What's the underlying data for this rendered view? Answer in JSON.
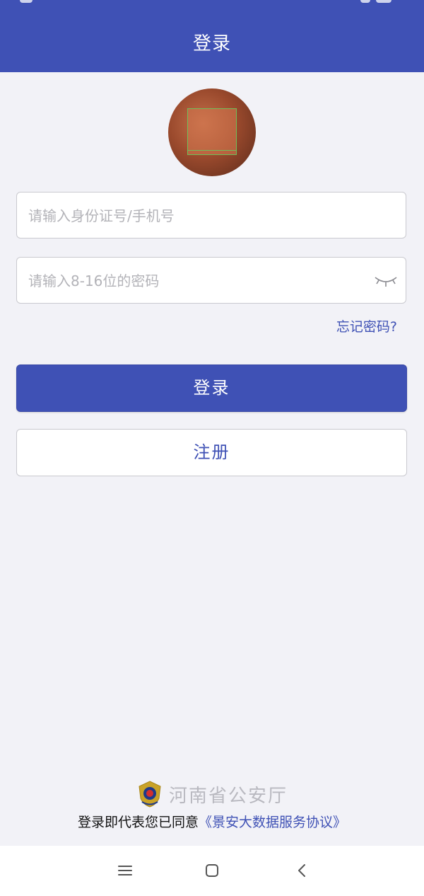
{
  "header": {
    "title": "登录"
  },
  "form": {
    "account_placeholder": "请输入身份证号/手机号",
    "account_value": "",
    "password_placeholder": "请输入8-16位的密码",
    "password_value": "",
    "forgot_password": "忘记密码?"
  },
  "buttons": {
    "login_label": "登录",
    "register_label": "注册"
  },
  "footer": {
    "org_name": "河南省公安厅",
    "agreement_prefix": "登录即代表您已同意",
    "agreement_link": "《景安大数据服务协议》"
  },
  "icons": {
    "password_toggle": "eye-closed-icon",
    "org_badge": "police-badge-icon",
    "nav_menu": "menu-icon",
    "nav_home": "home-square-icon",
    "nav_back": "back-chevron-icon"
  },
  "colors": {
    "primary": "#3f51b5",
    "background": "#f2f2f7",
    "placeholder": "#b3b3b8",
    "org_text": "#b9b9c0"
  }
}
